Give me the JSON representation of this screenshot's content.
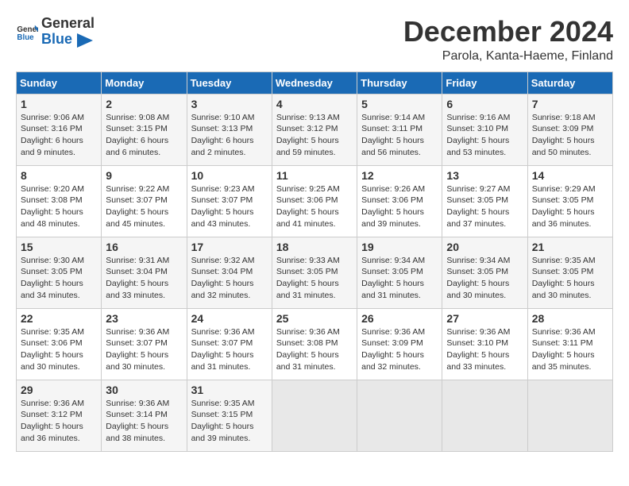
{
  "header": {
    "logo_general": "General",
    "logo_blue": "Blue",
    "month_title": "December 2024",
    "location": "Parola, Kanta-Haeme, Finland"
  },
  "days_of_week": [
    "Sunday",
    "Monday",
    "Tuesday",
    "Wednesday",
    "Thursday",
    "Friday",
    "Saturday"
  ],
  "weeks": [
    [
      {
        "day": 1,
        "lines": [
          "Sunrise: 9:06 AM",
          "Sunset: 3:16 PM",
          "Daylight: 6 hours",
          "and 9 minutes."
        ]
      },
      {
        "day": 2,
        "lines": [
          "Sunrise: 9:08 AM",
          "Sunset: 3:15 PM",
          "Daylight: 6 hours",
          "and 6 minutes."
        ]
      },
      {
        "day": 3,
        "lines": [
          "Sunrise: 9:10 AM",
          "Sunset: 3:13 PM",
          "Daylight: 6 hours",
          "and 2 minutes."
        ]
      },
      {
        "day": 4,
        "lines": [
          "Sunrise: 9:13 AM",
          "Sunset: 3:12 PM",
          "Daylight: 5 hours",
          "and 59 minutes."
        ]
      },
      {
        "day": 5,
        "lines": [
          "Sunrise: 9:14 AM",
          "Sunset: 3:11 PM",
          "Daylight: 5 hours",
          "and 56 minutes."
        ]
      },
      {
        "day": 6,
        "lines": [
          "Sunrise: 9:16 AM",
          "Sunset: 3:10 PM",
          "Daylight: 5 hours",
          "and 53 minutes."
        ]
      },
      {
        "day": 7,
        "lines": [
          "Sunrise: 9:18 AM",
          "Sunset: 3:09 PM",
          "Daylight: 5 hours",
          "and 50 minutes."
        ]
      }
    ],
    [
      {
        "day": 8,
        "lines": [
          "Sunrise: 9:20 AM",
          "Sunset: 3:08 PM",
          "Daylight: 5 hours",
          "and 48 minutes."
        ]
      },
      {
        "day": 9,
        "lines": [
          "Sunrise: 9:22 AM",
          "Sunset: 3:07 PM",
          "Daylight: 5 hours",
          "and 45 minutes."
        ]
      },
      {
        "day": 10,
        "lines": [
          "Sunrise: 9:23 AM",
          "Sunset: 3:07 PM",
          "Daylight: 5 hours",
          "and 43 minutes."
        ]
      },
      {
        "day": 11,
        "lines": [
          "Sunrise: 9:25 AM",
          "Sunset: 3:06 PM",
          "Daylight: 5 hours",
          "and 41 minutes."
        ]
      },
      {
        "day": 12,
        "lines": [
          "Sunrise: 9:26 AM",
          "Sunset: 3:06 PM",
          "Daylight: 5 hours",
          "and 39 minutes."
        ]
      },
      {
        "day": 13,
        "lines": [
          "Sunrise: 9:27 AM",
          "Sunset: 3:05 PM",
          "Daylight: 5 hours",
          "and 37 minutes."
        ]
      },
      {
        "day": 14,
        "lines": [
          "Sunrise: 9:29 AM",
          "Sunset: 3:05 PM",
          "Daylight: 5 hours",
          "and 36 minutes."
        ]
      }
    ],
    [
      {
        "day": 15,
        "lines": [
          "Sunrise: 9:30 AM",
          "Sunset: 3:05 PM",
          "Daylight: 5 hours",
          "and 34 minutes."
        ]
      },
      {
        "day": 16,
        "lines": [
          "Sunrise: 9:31 AM",
          "Sunset: 3:04 PM",
          "Daylight: 5 hours",
          "and 33 minutes."
        ]
      },
      {
        "day": 17,
        "lines": [
          "Sunrise: 9:32 AM",
          "Sunset: 3:04 PM",
          "Daylight: 5 hours",
          "and 32 minutes."
        ]
      },
      {
        "day": 18,
        "lines": [
          "Sunrise: 9:33 AM",
          "Sunset: 3:05 PM",
          "Daylight: 5 hours",
          "and 31 minutes."
        ]
      },
      {
        "day": 19,
        "lines": [
          "Sunrise: 9:34 AM",
          "Sunset: 3:05 PM",
          "Daylight: 5 hours",
          "and 31 minutes."
        ]
      },
      {
        "day": 20,
        "lines": [
          "Sunrise: 9:34 AM",
          "Sunset: 3:05 PM",
          "Daylight: 5 hours",
          "and 30 minutes."
        ]
      },
      {
        "day": 21,
        "lines": [
          "Sunrise: 9:35 AM",
          "Sunset: 3:05 PM",
          "Daylight: 5 hours",
          "and 30 minutes."
        ]
      }
    ],
    [
      {
        "day": 22,
        "lines": [
          "Sunrise: 9:35 AM",
          "Sunset: 3:06 PM",
          "Daylight: 5 hours",
          "and 30 minutes."
        ]
      },
      {
        "day": 23,
        "lines": [
          "Sunrise: 9:36 AM",
          "Sunset: 3:07 PM",
          "Daylight: 5 hours",
          "and 30 minutes."
        ]
      },
      {
        "day": 24,
        "lines": [
          "Sunrise: 9:36 AM",
          "Sunset: 3:07 PM",
          "Daylight: 5 hours",
          "and 31 minutes."
        ]
      },
      {
        "day": 25,
        "lines": [
          "Sunrise: 9:36 AM",
          "Sunset: 3:08 PM",
          "Daylight: 5 hours",
          "and 31 minutes."
        ]
      },
      {
        "day": 26,
        "lines": [
          "Sunrise: 9:36 AM",
          "Sunset: 3:09 PM",
          "Daylight: 5 hours",
          "and 32 minutes."
        ]
      },
      {
        "day": 27,
        "lines": [
          "Sunrise: 9:36 AM",
          "Sunset: 3:10 PM",
          "Daylight: 5 hours",
          "and 33 minutes."
        ]
      },
      {
        "day": 28,
        "lines": [
          "Sunrise: 9:36 AM",
          "Sunset: 3:11 PM",
          "Daylight: 5 hours",
          "and 35 minutes."
        ]
      }
    ],
    [
      {
        "day": 29,
        "lines": [
          "Sunrise: 9:36 AM",
          "Sunset: 3:12 PM",
          "Daylight: 5 hours",
          "and 36 minutes."
        ]
      },
      {
        "day": 30,
        "lines": [
          "Sunrise: 9:36 AM",
          "Sunset: 3:14 PM",
          "Daylight: 5 hours",
          "and 38 minutes."
        ]
      },
      {
        "day": 31,
        "lines": [
          "Sunrise: 9:35 AM",
          "Sunset: 3:15 PM",
          "Daylight: 5 hours",
          "and 39 minutes."
        ]
      },
      null,
      null,
      null,
      null
    ]
  ]
}
